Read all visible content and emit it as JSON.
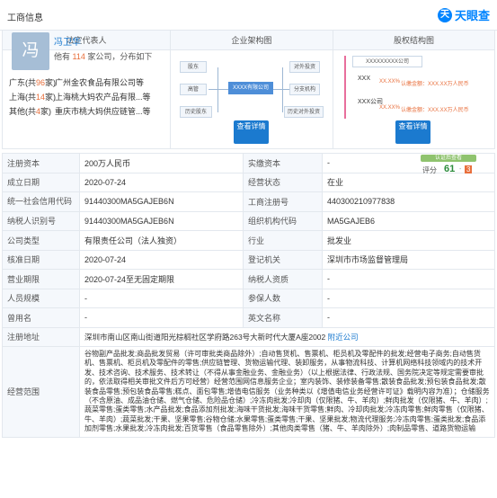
{
  "header": {
    "title": "工商信息",
    "logo_text": "天眼查",
    "logo_mark": "天"
  },
  "sections": {
    "legal_rep": "法定代表人",
    "structure": "企业架构图",
    "equity": "股权结构图"
  },
  "legal": {
    "avatar_char": "冯",
    "name": "冯卫华",
    "sub_pre": "他有",
    "sub_count": "114",
    "sub_post": "家公司，分布如下",
    "regions": [
      {
        "region": "广东",
        "count_pre": "(共",
        "count": "96",
        "count_post": "家)",
        "company": "广州金农食品有限公司等"
      },
      {
        "region": "上海",
        "count_pre": "(共",
        "count": "14",
        "count_post": "家)",
        "company": "上海桃大妈农产品有限...等"
      },
      {
        "region": "其他",
        "count_pre": "(共",
        "count": "4",
        "count_post": "家)",
        "company": "重庆市桃大妈供应链管...等"
      }
    ]
  },
  "structure": {
    "shareholder": "股东",
    "executive": "高管",
    "history": "历史股东",
    "center": "XXXX有限公司",
    "investment": "对外投资",
    "branch": "分支机构",
    "history_invest": "历史对外投资",
    "button": "查看详情"
  },
  "equity": {
    "top": "XXXXXXXXX公司",
    "p1": "XXX",
    "p1_note": "认缴金额：XXX.XX万人民币",
    "p1_ratio": "XX.XX%",
    "p2": "XXX公司",
    "p2_note": "认缴金额：XXX.XX万人民币",
    "p2_ratio": "XX.XX%",
    "button": "查看详情"
  },
  "score": {
    "label": "认证后查看",
    "prefix": "评分",
    "value": "61",
    "suffix": "3"
  },
  "table": {
    "rows": [
      [
        {
          "k": "注册资本",
          "v": "200万人民币"
        },
        {
          "k": "实缴资本",
          "v": "-"
        }
      ],
      [
        {
          "k": "成立日期",
          "v": "2020-07-24"
        },
        {
          "k": "经营状态",
          "v": "在业"
        }
      ],
      [
        {
          "k": "统一社会信用代码",
          "v": "91440300MA5GAJEB6N"
        },
        {
          "k": "工商注册号",
          "v": "440300210977838"
        }
      ],
      [
        {
          "k": "纳税人识别号",
          "v": "91440300MA5GAJEB6N"
        },
        {
          "k": "组织机构代码",
          "v": "MA5GAJEB6"
        }
      ],
      [
        {
          "k": "公司类型",
          "v": "有限责任公司（法人独资）"
        },
        {
          "k": "行业",
          "v": "批发业"
        }
      ],
      [
        {
          "k": "核准日期",
          "v": "2020-07-24"
        },
        {
          "k": "登记机关",
          "v": "深圳市市场监督管理局"
        }
      ],
      [
        {
          "k": "营业期限",
          "v": "2020-07-24至无固定期限"
        },
        {
          "k": "纳税人资质",
          "v": "-"
        }
      ],
      [
        {
          "k": "人员规模",
          "v": "-"
        },
        {
          "k": "参保人数",
          "v": "-"
        }
      ],
      [
        {
          "k": "曾用名",
          "v": "-"
        },
        {
          "k": "英文名称",
          "v": "-"
        }
      ]
    ],
    "address_label": "注册地址",
    "address": "深圳市南山区南山街道阳光棕榈社区学府路263号大新时代大厦A座2002",
    "address_link": "附近公司",
    "scope_label": "经营范围",
    "scope": "谷物副产品批发;商品批发贸易（许可审批类商品除外）;自动售货机、售票机、柜员机及零配件的批发;经营电子商务;自动售货机、售票机、柜员机及零配件的零售;供应链管理、货物运输代理、装卸服务，从事物流科技、计算机网络科技领域内的技术开发、技术咨询、技术服务、技术转让（不得从事金融业务、金融业务）（以上根据法律、行政法规、国务院决定等规定需要审批的，依法取得相关审批文件后方可经营）经营范围网信息服务企业；室内装饰、装修装备零售;散装食品批发;预包装食品批发;散装食品零售;预包装食品零售;糕点、面包零售;增值电信服务（业务种类以《增值电信业务经营许可证》载明内容为准）；仓储服务（不含原油、成品油仓储、燃气仓储、危险品仓储）;冷冻肉批发;冷却肉（仅限猪、牛、羊肉）;鲜肉批发（仅限猪、牛、羊肉）;蔬菜零售;蛋类零售;水产品批发;食品添加剂批发;海味干货批发;海味干货零售;鲜肉、冷却肉批发;冷冻肉零售;鲜肉零售（仅限猪、牛、羊肉）;蔬菜批发;干果、坚果零售;谷物仓储;水果零售;蛋类零售;干果、坚果批发;物流代理服务;冷冻肉零售;蛋类批发;食品添加剂零售;水果批发;冷冻肉批发;百货零售（食品零售除外）;其他肉类零售（猪、牛、羊肉除外）;肉制品零售、道路货物运输"
  }
}
